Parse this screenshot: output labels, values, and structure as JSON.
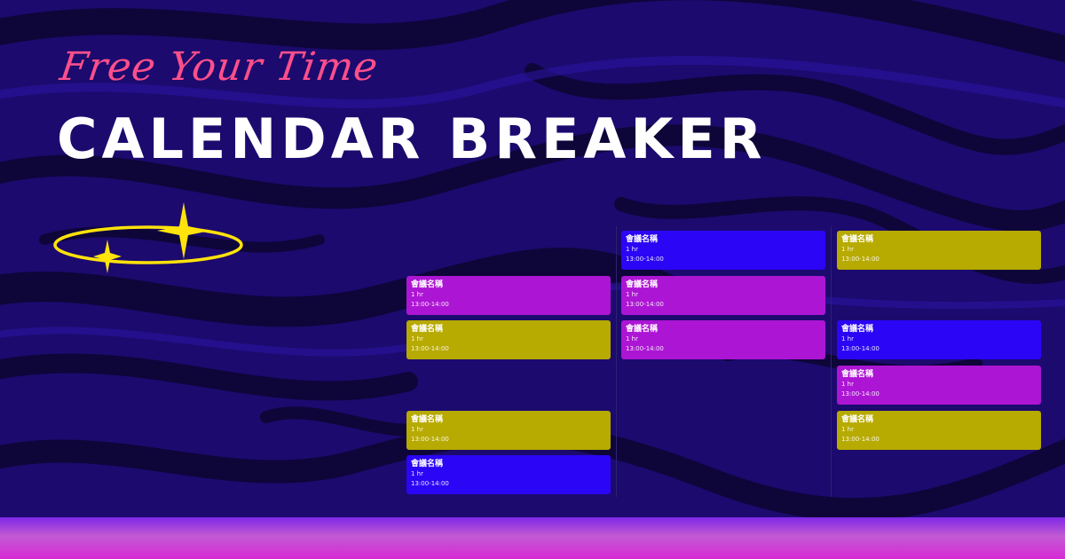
{
  "header": {
    "tagline": "Free Your Time",
    "title": "CALENDAR BREAKER"
  },
  "colors": {
    "background": "#1c0a6e",
    "tagline": "#ff4f8b",
    "title": "#ffffff",
    "sparkle": "#ffe30a",
    "event_purple": "#ad15d4",
    "event_olive": "#b7aa00",
    "event_blue": "#2b05f5"
  },
  "calendar": {
    "columns": [
      {
        "events": [
          {
            "name": "會議名稱",
            "duration": "1 hr",
            "time": "13:00-14:00",
            "color": "purple"
          },
          {
            "name": "會議名稱",
            "duration": "1 hr",
            "time": "13:00-14:00",
            "color": "olive"
          },
          {
            "name": "會議名稱",
            "duration": "1 hr",
            "time": "13:00-14:00",
            "color": "olive"
          },
          {
            "name": "會議名稱",
            "duration": "1 hr",
            "time": "13:00-14:00",
            "color": "blue"
          }
        ]
      },
      {
        "events": [
          {
            "name": "會議名稱",
            "duration": "1 hr",
            "time": "13:00-14:00",
            "color": "blue"
          },
          {
            "name": "會議名稱",
            "duration": "1 hr",
            "time": "13:00-14:00",
            "color": "purple"
          },
          {
            "name": "會議名稱",
            "duration": "1 hr",
            "time": "13:00-14:00",
            "color": "purple"
          }
        ]
      },
      {
        "events": [
          {
            "name": "會議名稱",
            "duration": "1 hr",
            "time": "13:00-14:00",
            "color": "olive"
          },
          {
            "name": "會議名稱",
            "duration": "1 hr",
            "time": "13:00-14:00",
            "color": "blue"
          },
          {
            "name": "會議名稱",
            "duration": "1 hr",
            "time": "13:00-14:00",
            "color": "purple"
          },
          {
            "name": "會議名稱",
            "duration": "1 hr",
            "time": "13:00-14:00",
            "color": "olive"
          }
        ]
      }
    ]
  }
}
